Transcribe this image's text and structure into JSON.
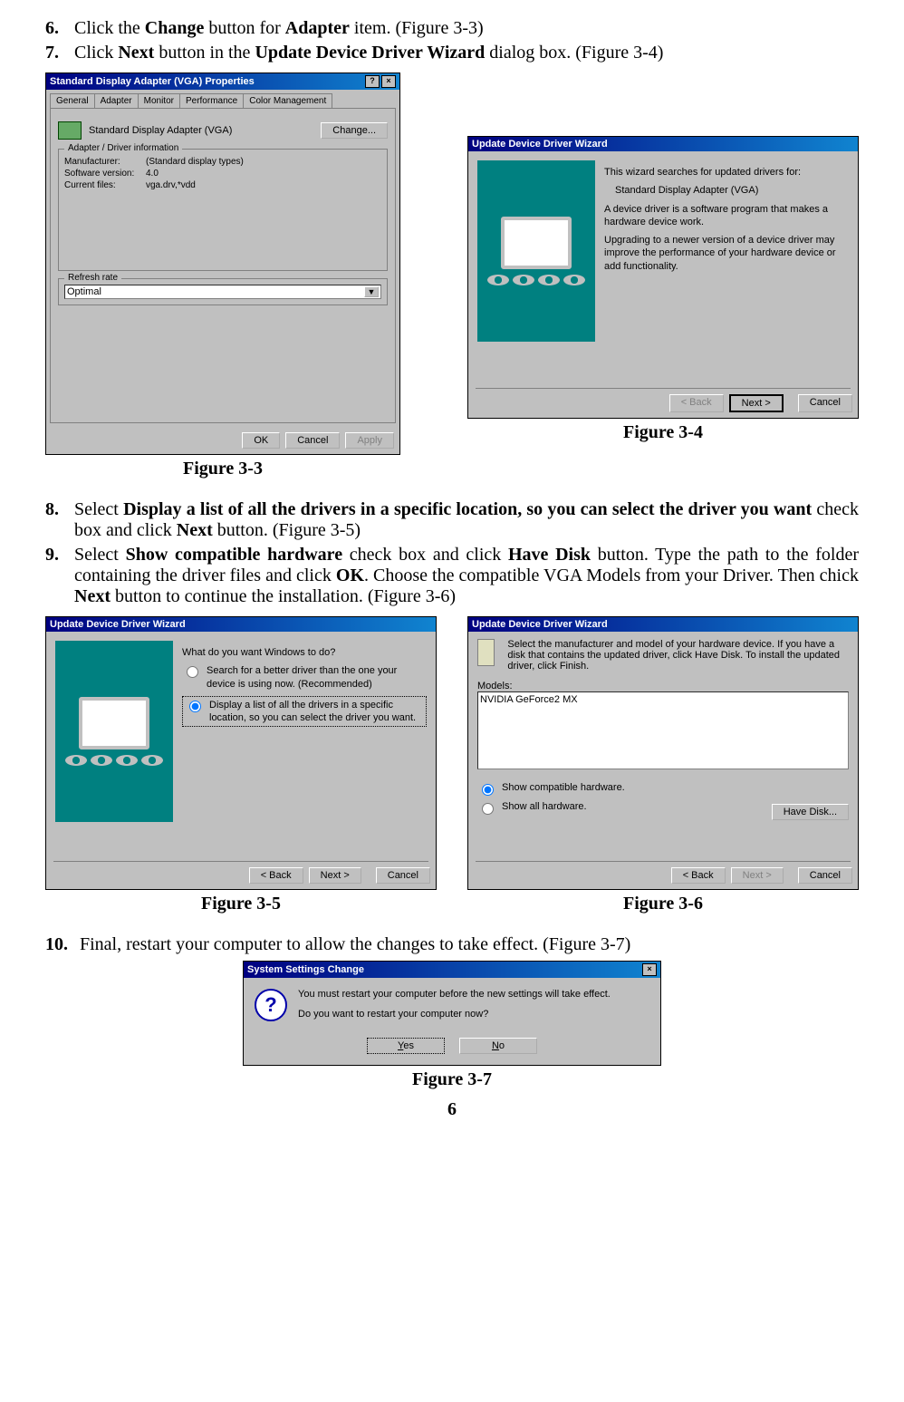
{
  "steps": {
    "s6": {
      "num": "6.",
      "body_pre": "Click the ",
      "b1": "Change",
      "mid1": " button for ",
      "b2": "Adapter",
      "mid2": " item. (Figure 3-3)"
    },
    "s7": {
      "num": "7.",
      "body_pre": "Click ",
      "b1": "Next",
      "mid1": " button in the ",
      "b2": "Update Device Driver Wizard",
      "mid2": " dialog box. (Figure 3-4)"
    },
    "s8": {
      "num": "8.",
      "body_pre": "Select ",
      "b1": "Display a list of all the drivers in a specific location, so you can select the driver you want",
      "mid1": " check box and click ",
      "b2": "Next",
      "mid2": " button. (Figure 3-5)"
    },
    "s9": {
      "num": "9.",
      "pre": "Select ",
      "b1": "Show compatible hardware",
      "mid1": " check box and click ",
      "b2": "Have Disk",
      "mid2": " button. Type the path to the folder containing the driver files and click ",
      "b3": "OK",
      "mid3": ".  Choose the compatible VGA Models from your Driver.  Then chick ",
      "b4": "Next",
      "mid4": " button to continue the installation. (Figure 3-6)"
    },
    "s10": {
      "num": "10.",
      "body": "Final, restart your computer to allow the changes to take effect. (Figure 3-7)"
    }
  },
  "captions": {
    "f33": "Figure 3-3",
    "f34": "Figure 3-4",
    "f35": "Figure 3-5",
    "f36": "Figure 3-6",
    "f37": "Figure 3-7"
  },
  "fig33": {
    "title": "Standard Display Adapter (VGA) Properties",
    "tabs": {
      "t1": "General",
      "t2": "Adapter",
      "t3": "Monitor",
      "t4": "Performance",
      "t5": "Color Management"
    },
    "adapter_name": "Standard Display Adapter (VGA)",
    "change": "Change...",
    "group1": "Adapter / Driver information",
    "manufacturer_lbl": "Manufacturer:",
    "manufacturer_val": "(Standard display types)",
    "swver_lbl": "Software version:",
    "swver_val": "4.0",
    "files_lbl": "Current files:",
    "files_val": "vga.drv,*vdd",
    "refresh_lbl": "Refresh rate",
    "refresh_val": "Optimal",
    "ok": "OK",
    "cancel": "Cancel",
    "apply": "Apply"
  },
  "fig34": {
    "title": "Update Device Driver Wizard",
    "p1": "This wizard searches for updated drivers for:",
    "p2": "Standard Display Adapter (VGA)",
    "p3": "A device driver is a software program that makes a hardware device work.",
    "p4": "Upgrading to a newer version of a device driver may improve the performance of your hardware device or add functionality.",
    "back": "< Back",
    "next": "Next >",
    "cancel": "Cancel"
  },
  "fig35": {
    "title": "Update Device Driver Wizard",
    "q": "What do you want Windows to do?",
    "r1": "Search for a better driver than the one your device is using now. (Recommended)",
    "r2": "Display a list of all the drivers in a specific location, so you can select the driver you want.",
    "back": "< Back",
    "next": "Next >",
    "cancel": "Cancel"
  },
  "fig36": {
    "title": "Update Device Driver Wizard",
    "desc": "Select the manufacturer and model of your hardware device. If you have a disk that contains the updated driver, click Have Disk. To install the updated driver, click Finish.",
    "models_lbl": "Models:",
    "model_item": "NVIDIA GeForce2 MX",
    "show_compat": "Show compatible hardware.",
    "show_all": "Show all hardware.",
    "have_disk": "Have Disk...",
    "back": "< Back",
    "next": "Next >",
    "cancel": "Cancel"
  },
  "fig37": {
    "title": "System Settings Change",
    "msg1": "You must restart your computer before the new settings will take effect.",
    "msg2": "Do you want to restart your computer now?",
    "yes": "Yes",
    "no": "No"
  },
  "page_number": "6"
}
